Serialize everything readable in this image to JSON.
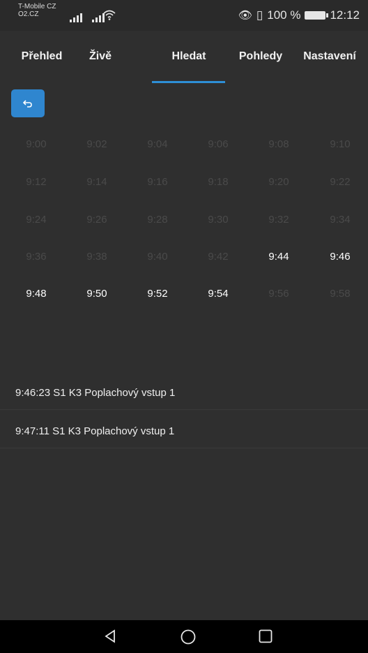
{
  "status_bar": {
    "carrier_line1": "T-Mobile CZ",
    "carrier_line2": "O2.CZ",
    "battery_percent": "100 %",
    "time": "12:12"
  },
  "tabs": [
    {
      "label": "Přehled",
      "active": false
    },
    {
      "label": "Živě",
      "active": false
    },
    {
      "label": "Hledat",
      "active": true
    },
    {
      "label": "Pohledy",
      "active": false
    },
    {
      "label": "Nastavení",
      "active": false
    }
  ],
  "accent_color": "#2f86cf",
  "times": [
    {
      "label": "9:00",
      "enabled": false
    },
    {
      "label": "9:02",
      "enabled": false
    },
    {
      "label": "9:04",
      "enabled": false
    },
    {
      "label": "9:06",
      "enabled": false
    },
    {
      "label": "9:08",
      "enabled": false
    },
    {
      "label": "9:10",
      "enabled": false
    },
    {
      "label": "9:12",
      "enabled": false
    },
    {
      "label": "9:14",
      "enabled": false
    },
    {
      "label": "9:16",
      "enabled": false
    },
    {
      "label": "9:18",
      "enabled": false
    },
    {
      "label": "9:20",
      "enabled": false
    },
    {
      "label": "9:22",
      "enabled": false
    },
    {
      "label": "9:24",
      "enabled": false
    },
    {
      "label": "9:26",
      "enabled": false
    },
    {
      "label": "9:28",
      "enabled": false
    },
    {
      "label": "9:30",
      "enabled": false
    },
    {
      "label": "9:32",
      "enabled": false
    },
    {
      "label": "9:34",
      "enabled": false
    },
    {
      "label": "9:36",
      "enabled": false
    },
    {
      "label": "9:38",
      "enabled": false
    },
    {
      "label": "9:40",
      "enabled": false
    },
    {
      "label": "9:42",
      "enabled": false
    },
    {
      "label": "9:44",
      "enabled": true
    },
    {
      "label": "9:46",
      "enabled": true
    },
    {
      "label": "9:48",
      "enabled": true
    },
    {
      "label": "9:50",
      "enabled": true
    },
    {
      "label": "9:52",
      "enabled": true
    },
    {
      "label": "9:54",
      "enabled": true
    },
    {
      "label": "9:56",
      "enabled": false
    },
    {
      "label": "9:58",
      "enabled": false
    }
  ],
  "events": [
    {
      "text": "9:46:23 S1 K3 Poplachový vstup 1"
    },
    {
      "text": "9:47:11 S1 K3 Poplachový vstup 1"
    }
  ],
  "icons": {
    "back": "undo-arrow-icon",
    "nav_back": "triangle-back-icon",
    "nav_home": "circle-home-icon",
    "nav_recents": "square-recents-icon"
  }
}
